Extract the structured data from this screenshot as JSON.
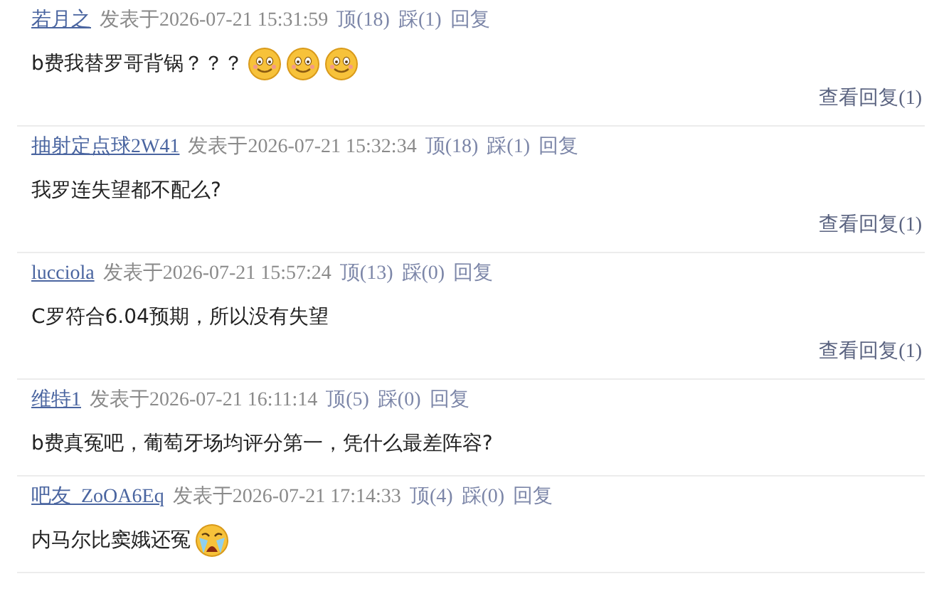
{
  "comments": [
    {
      "author": "若月之",
      "posted": "发表于2026-07-21 15:31:59",
      "up": "顶(18)",
      "down": "踩(1)",
      "reply": "回复",
      "body": "b费我替罗哥背锅？？？",
      "emoticons": [
        {
          "kind": "smile"
        },
        {
          "kind": "smile"
        },
        {
          "kind": "smile"
        }
      ],
      "view_replies": "查看回复(1)"
    },
    {
      "author": "抽射定点球2W41",
      "posted": "发表于2026-07-21 15:32:34",
      "up": "顶(18)",
      "down": "踩(1)",
      "reply": "回复",
      "body": "我罗连失望都不配么?",
      "view_replies": "查看回复(1)"
    },
    {
      "author": "lucciola",
      "posted": "发表于2026-07-21 15:57:24",
      "up": "顶(13)",
      "down": "踩(0)",
      "reply": "回复",
      "body": "C罗符合6.04预期，所以没有失望",
      "view_replies": "查看回复(1)"
    },
    {
      "author": "维特1",
      "posted": "发表于2026-07-21 16:11:14",
      "up": "顶(5)",
      "down": "踩(0)",
      "reply": "回复",
      "body": "b费真冤吧，葡萄牙场均评分第一，凭什么最差阵容?"
    },
    {
      "author": "吧友_ZoOA6Eq",
      "posted": "发表于2026-07-21 17:14:33",
      "up": "顶(4)",
      "down": "踩(0)",
      "reply": "回复",
      "body": "内马尔比窦娥还冤",
      "emoticons": [
        {
          "kind": "cry"
        }
      ]
    }
  ]
}
